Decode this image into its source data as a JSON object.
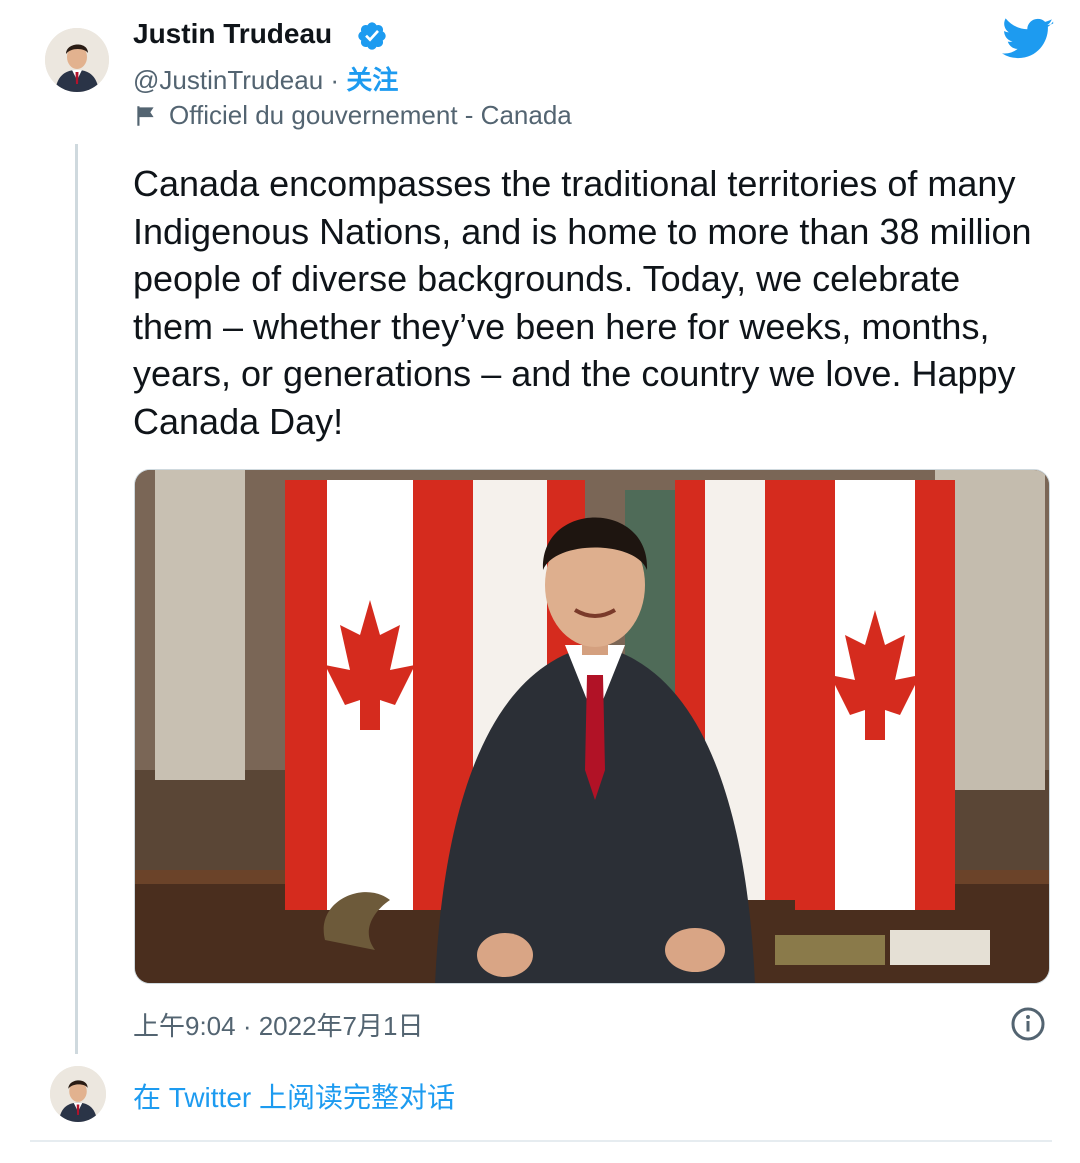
{
  "author": {
    "name": "Justin Trudeau",
    "handle": "@JustinTrudeau",
    "separator": " · ",
    "follow_label": "关注",
    "gov_label": "Officiel du gouvernement - Canada"
  },
  "tweet": {
    "text": "Canada encompasses the traditional territories of many Indigenous Nations, and is home to more than 38 million people of diverse backgrounds. Today, we celebrate them – whether they’ve been here for weeks, months, years, or generations – and the country we love. Happy Canada Day!",
    "timestamp": "上午9:04 · 2022年7月1日"
  },
  "footer": {
    "read_more_label": "在 Twitter 上阅读完整对话"
  },
  "icons": {
    "verified": "verified-badge-icon",
    "gov": "flag-icon",
    "brand": "twitter-bird-icon",
    "info": "info-icon"
  },
  "colors": {
    "accent": "#1d9bf0",
    "text": "#0f1419",
    "secondary": "#536471",
    "flag_red": "#d52b1e"
  }
}
